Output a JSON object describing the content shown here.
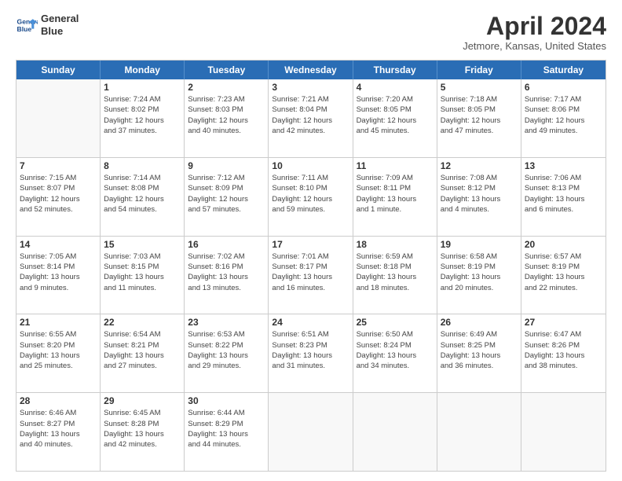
{
  "header": {
    "logo_line1": "General",
    "logo_line2": "Blue",
    "title": "April 2024",
    "location": "Jetmore, Kansas, United States"
  },
  "days_of_week": [
    "Sunday",
    "Monday",
    "Tuesday",
    "Wednesday",
    "Thursday",
    "Friday",
    "Saturday"
  ],
  "weeks": [
    [
      {
        "day": "",
        "info": ""
      },
      {
        "day": "1",
        "info": "Sunrise: 7:24 AM\nSunset: 8:02 PM\nDaylight: 12 hours\nand 37 minutes."
      },
      {
        "day": "2",
        "info": "Sunrise: 7:23 AM\nSunset: 8:03 PM\nDaylight: 12 hours\nand 40 minutes."
      },
      {
        "day": "3",
        "info": "Sunrise: 7:21 AM\nSunset: 8:04 PM\nDaylight: 12 hours\nand 42 minutes."
      },
      {
        "day": "4",
        "info": "Sunrise: 7:20 AM\nSunset: 8:05 PM\nDaylight: 12 hours\nand 45 minutes."
      },
      {
        "day": "5",
        "info": "Sunrise: 7:18 AM\nSunset: 8:05 PM\nDaylight: 12 hours\nand 47 minutes."
      },
      {
        "day": "6",
        "info": "Sunrise: 7:17 AM\nSunset: 8:06 PM\nDaylight: 12 hours\nand 49 minutes."
      }
    ],
    [
      {
        "day": "7",
        "info": "Sunrise: 7:15 AM\nSunset: 8:07 PM\nDaylight: 12 hours\nand 52 minutes."
      },
      {
        "day": "8",
        "info": "Sunrise: 7:14 AM\nSunset: 8:08 PM\nDaylight: 12 hours\nand 54 minutes."
      },
      {
        "day": "9",
        "info": "Sunrise: 7:12 AM\nSunset: 8:09 PM\nDaylight: 12 hours\nand 57 minutes."
      },
      {
        "day": "10",
        "info": "Sunrise: 7:11 AM\nSunset: 8:10 PM\nDaylight: 12 hours\nand 59 minutes."
      },
      {
        "day": "11",
        "info": "Sunrise: 7:09 AM\nSunset: 8:11 PM\nDaylight: 13 hours\nand 1 minute."
      },
      {
        "day": "12",
        "info": "Sunrise: 7:08 AM\nSunset: 8:12 PM\nDaylight: 13 hours\nand 4 minutes."
      },
      {
        "day": "13",
        "info": "Sunrise: 7:06 AM\nSunset: 8:13 PM\nDaylight: 13 hours\nand 6 minutes."
      }
    ],
    [
      {
        "day": "14",
        "info": "Sunrise: 7:05 AM\nSunset: 8:14 PM\nDaylight: 13 hours\nand 9 minutes."
      },
      {
        "day": "15",
        "info": "Sunrise: 7:03 AM\nSunset: 8:15 PM\nDaylight: 13 hours\nand 11 minutes."
      },
      {
        "day": "16",
        "info": "Sunrise: 7:02 AM\nSunset: 8:16 PM\nDaylight: 13 hours\nand 13 minutes."
      },
      {
        "day": "17",
        "info": "Sunrise: 7:01 AM\nSunset: 8:17 PM\nDaylight: 13 hours\nand 16 minutes."
      },
      {
        "day": "18",
        "info": "Sunrise: 6:59 AM\nSunset: 8:18 PM\nDaylight: 13 hours\nand 18 minutes."
      },
      {
        "day": "19",
        "info": "Sunrise: 6:58 AM\nSunset: 8:19 PM\nDaylight: 13 hours\nand 20 minutes."
      },
      {
        "day": "20",
        "info": "Sunrise: 6:57 AM\nSunset: 8:19 PM\nDaylight: 13 hours\nand 22 minutes."
      }
    ],
    [
      {
        "day": "21",
        "info": "Sunrise: 6:55 AM\nSunset: 8:20 PM\nDaylight: 13 hours\nand 25 minutes."
      },
      {
        "day": "22",
        "info": "Sunrise: 6:54 AM\nSunset: 8:21 PM\nDaylight: 13 hours\nand 27 minutes."
      },
      {
        "day": "23",
        "info": "Sunrise: 6:53 AM\nSunset: 8:22 PM\nDaylight: 13 hours\nand 29 minutes."
      },
      {
        "day": "24",
        "info": "Sunrise: 6:51 AM\nSunset: 8:23 PM\nDaylight: 13 hours\nand 31 minutes."
      },
      {
        "day": "25",
        "info": "Sunrise: 6:50 AM\nSunset: 8:24 PM\nDaylight: 13 hours\nand 34 minutes."
      },
      {
        "day": "26",
        "info": "Sunrise: 6:49 AM\nSunset: 8:25 PM\nDaylight: 13 hours\nand 36 minutes."
      },
      {
        "day": "27",
        "info": "Sunrise: 6:47 AM\nSunset: 8:26 PM\nDaylight: 13 hours\nand 38 minutes."
      }
    ],
    [
      {
        "day": "28",
        "info": "Sunrise: 6:46 AM\nSunset: 8:27 PM\nDaylight: 13 hours\nand 40 minutes."
      },
      {
        "day": "29",
        "info": "Sunrise: 6:45 AM\nSunset: 8:28 PM\nDaylight: 13 hours\nand 42 minutes."
      },
      {
        "day": "30",
        "info": "Sunrise: 6:44 AM\nSunset: 8:29 PM\nDaylight: 13 hours\nand 44 minutes."
      },
      {
        "day": "",
        "info": ""
      },
      {
        "day": "",
        "info": ""
      },
      {
        "day": "",
        "info": ""
      },
      {
        "day": "",
        "info": ""
      }
    ]
  ]
}
